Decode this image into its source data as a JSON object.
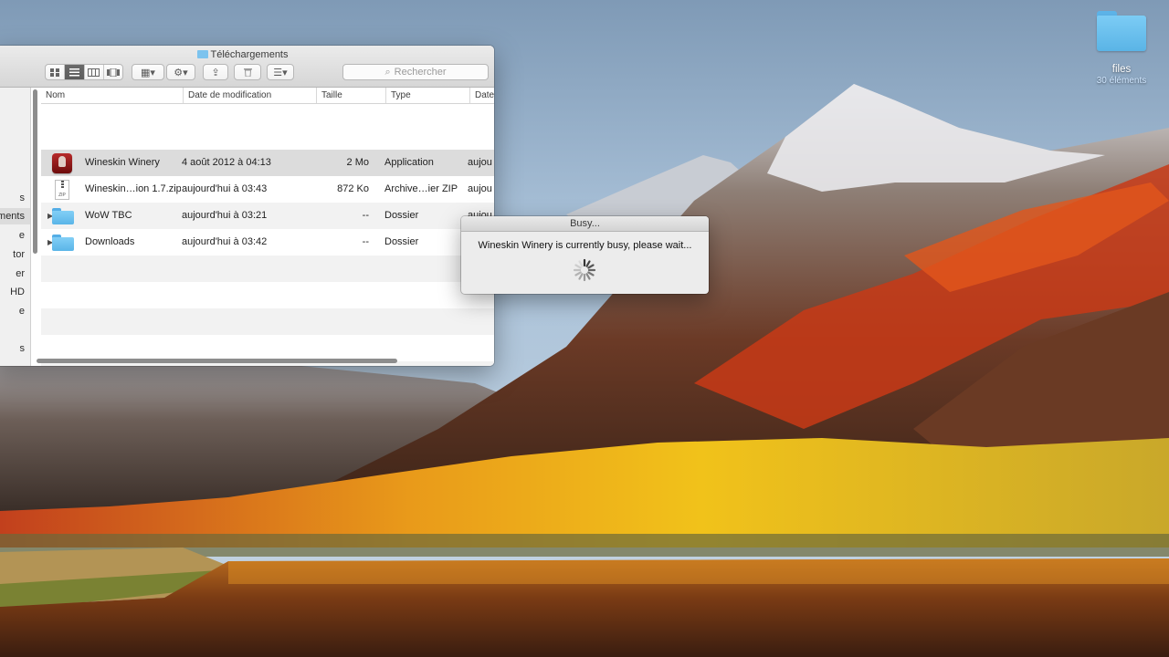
{
  "desktop": {
    "folder": {
      "name": "files",
      "subtitle": "30 éléments"
    }
  },
  "finder": {
    "title": "Téléchargements",
    "toolbar": {
      "view_icons": [
        "icon-view-icon",
        "list-view-icon",
        "column-view-icon",
        "cover-flow-icon"
      ],
      "group_label": "▦▾",
      "action_label": "⚙▾",
      "share_label": "⇪",
      "trash_label": "🗑",
      "sort_label": "☰▾"
    },
    "search": {
      "placeholder": "Rechercher"
    },
    "sidebar": {
      "items": [
        "s",
        "ments",
        "e",
        "tor",
        "er",
        "HD",
        "e",
        "s"
      ],
      "selected_index": 1
    },
    "columns": [
      "Nom",
      "Date de modification",
      "Taille",
      "Type",
      "Date"
    ],
    "rows": [
      {
        "name": "Wineskin Winery",
        "date": "4 août 2012 à 04:13",
        "size": "2 Mo",
        "type": "Application",
        "added": "aujou",
        "icon": "app-icon",
        "disclosure": ""
      },
      {
        "name": "Wineskin…ion 1.7.zip",
        "date": "aujourd'hui à 03:43",
        "size": "872 Ko",
        "type": "Archive…ier ZIP",
        "added": "aujou",
        "icon": "zip-icon",
        "zip_badge": "ZIP",
        "disclosure": ""
      },
      {
        "name": "WoW TBC",
        "date": "aujourd'hui à 03:21",
        "size": "--",
        "type": "Dossier",
        "added": "aujou",
        "icon": "folder-icon",
        "disclosure": "▶"
      },
      {
        "name": "Downloads",
        "date": "aujourd'hui à 03:42",
        "size": "--",
        "type": "Dossier",
        "added": "aujou",
        "icon": "folder-icon",
        "disclosure": "▶"
      }
    ]
  },
  "busy_dialog": {
    "title": "Busy...",
    "message": "Wineskin Winery is currently busy, please wait..."
  }
}
